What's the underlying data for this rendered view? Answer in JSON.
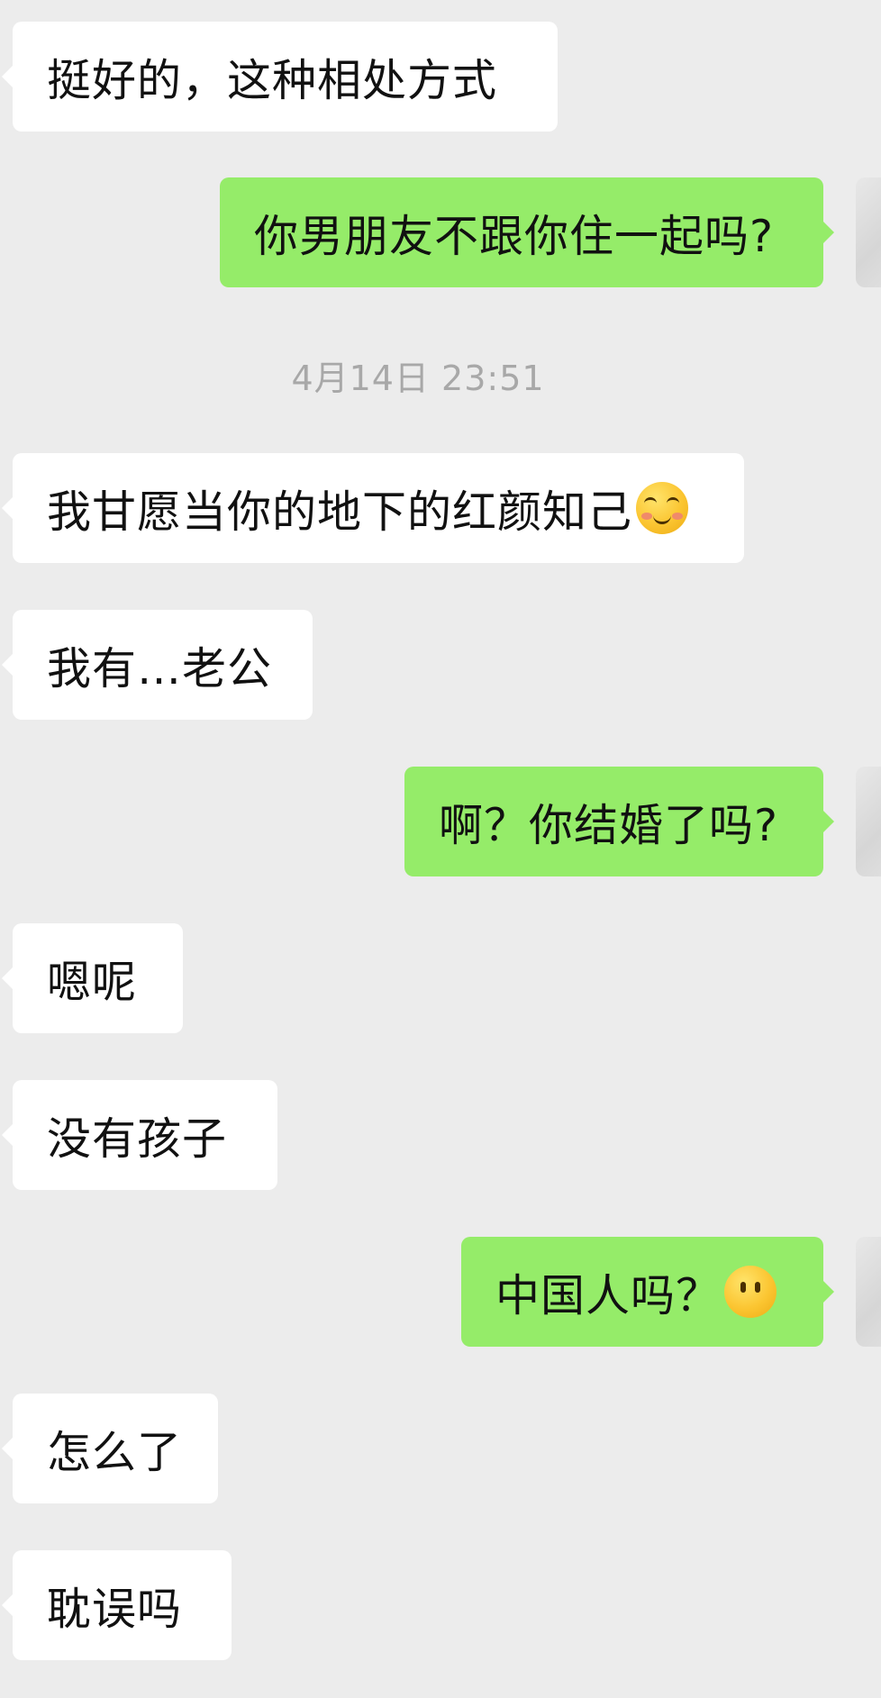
{
  "timestamp": "4月14日 23:51",
  "messages": [
    {
      "side": "in",
      "text": "挺好的，这种相处方式"
    },
    {
      "side": "out",
      "text": "你男朋友不跟你住一起吗?"
    },
    {
      "side": "in",
      "text": "我甘愿当你的地下的红颜知己",
      "emoji": "shy-smiling-face-emoji"
    },
    {
      "side": "in",
      "text": "我有…老公"
    },
    {
      "side": "out",
      "text": "啊？你结婚了吗?"
    },
    {
      "side": "in",
      "text": "嗯呢"
    },
    {
      "side": "in",
      "text": "没有孩子"
    },
    {
      "side": "out",
      "text": "中国人吗？",
      "emoji": "face-without-mouth-emoji"
    },
    {
      "side": "in",
      "text": "怎么了"
    },
    {
      "side": "in",
      "text": "耽误吗"
    }
  ],
  "colors": {
    "background": "#ececec",
    "incoming_bubble": "#ffffff",
    "outgoing_bubble": "#95ec69",
    "timestamp_text": "#a8a8a8"
  }
}
